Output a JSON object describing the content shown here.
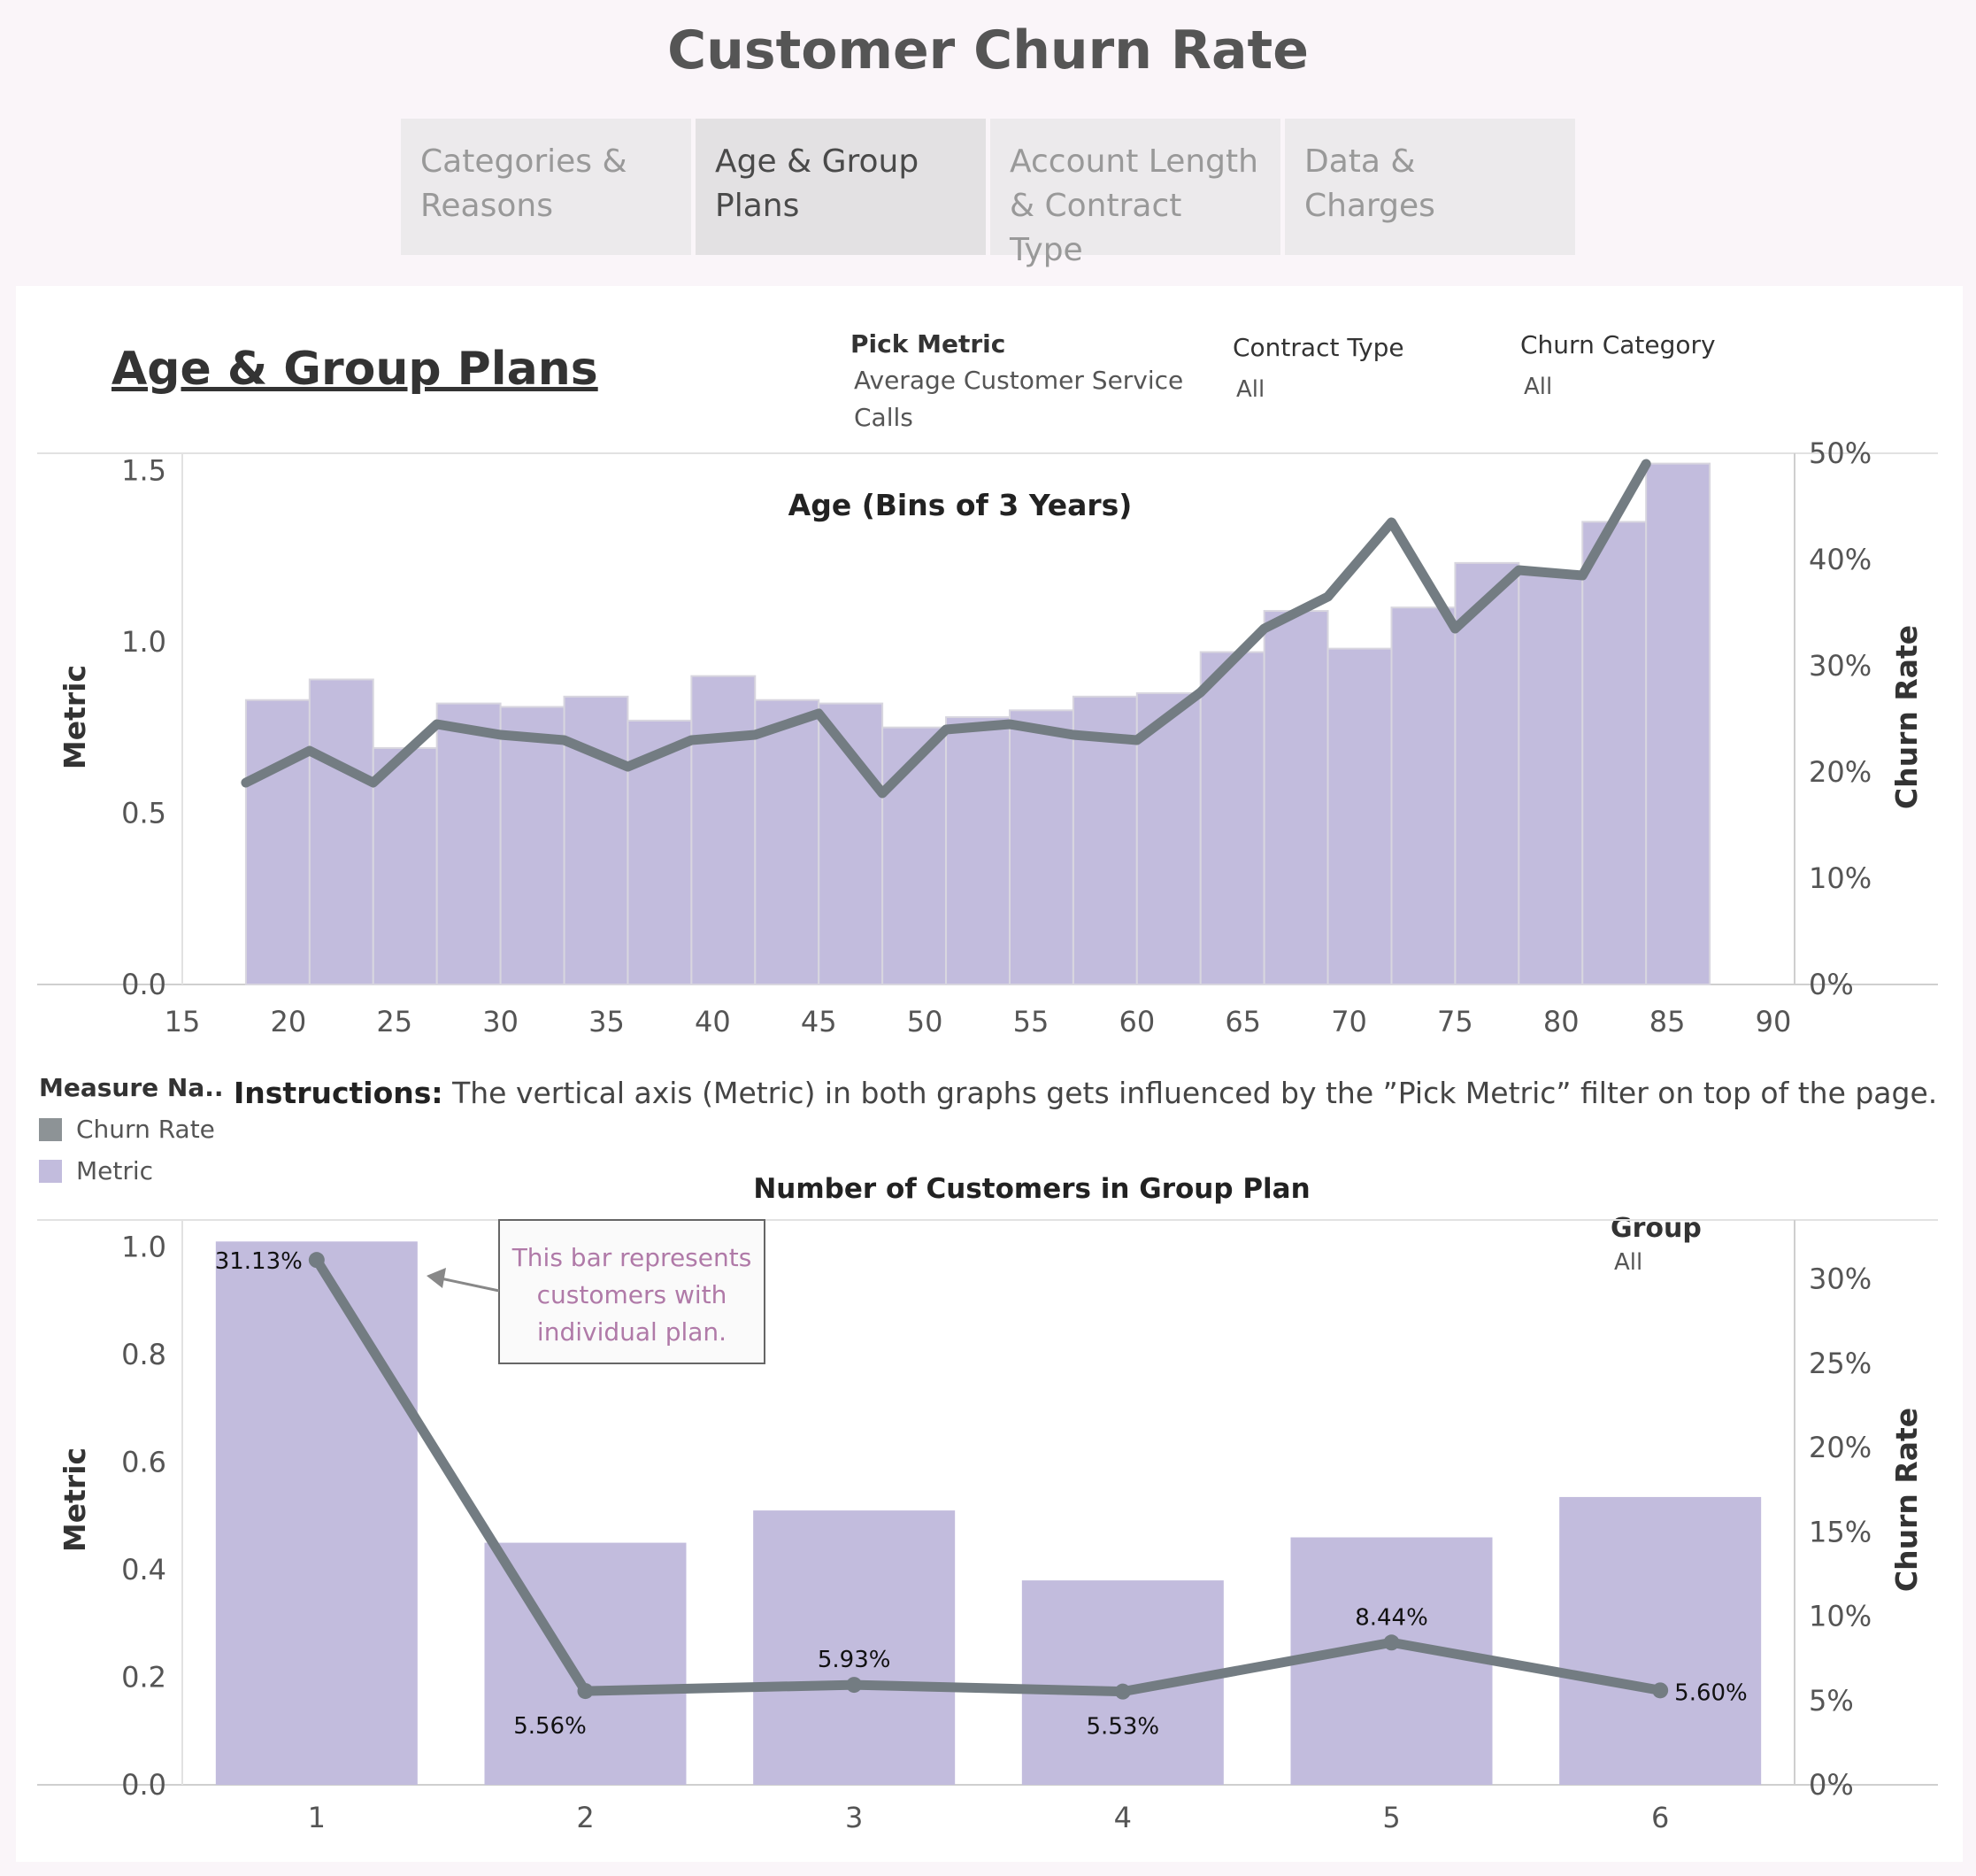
{
  "page_title": "Customer Churn Rate",
  "tabs": [
    {
      "label_lines": [
        "Categories &",
        "Reasons"
      ],
      "active": false
    },
    {
      "label_lines": [
        "Age & Group",
        "Plans"
      ],
      "active": true
    },
    {
      "label_lines": [
        "Account Length",
        "& Contract Type"
      ],
      "active": false
    },
    {
      "label_lines": [
        "Data & Charges"
      ],
      "active": false
    }
  ],
  "section_title": "Age & Group Plans",
  "filters": {
    "pick_metric": {
      "label": "Pick Metric",
      "value_lines": [
        "Average Customer Service",
        "Calls"
      ]
    },
    "contract_type": {
      "label": "Contract Type",
      "value": "All"
    },
    "churn_category": {
      "label": "Churn Category",
      "value": "All"
    },
    "group": {
      "label": "Group",
      "value": "All"
    }
  },
  "legend": {
    "title": "Measure Na..",
    "items": [
      {
        "label": "Churn Rate",
        "color": "#8d9396"
      },
      {
        "label": "Metric",
        "color": "#c2bcdd"
      }
    ]
  },
  "instructions": {
    "prefix": "Instructions:",
    "text": " The vertical axis (Metric) in both graphs gets influenced by the ”Pick Metric” filter on top of the page."
  },
  "colors": {
    "bar": "#c2bcdd",
    "bar_edge": "#d8d6df",
    "line": "#737c82",
    "annotation_text": "#b07aa8"
  },
  "chart_data": [
    {
      "type": "bar",
      "title": "Age (Bins of 3 Years)",
      "xlabel": "",
      "ylabel": "Metric",
      "y2label": "Churn Rate",
      "xlim": [
        15,
        91
      ],
      "ylim": [
        0,
        1.55
      ],
      "y2lim": [
        0,
        0.5
      ],
      "x_ticks": [
        15,
        20,
        25,
        30,
        35,
        40,
        45,
        50,
        55,
        60,
        65,
        70,
        75,
        80,
        85,
        90
      ],
      "y_ticks": [
        "0.0",
        "0.5",
        "1.0",
        "1.5"
      ],
      "y2_ticks": [
        "0%",
        "10%",
        "20%",
        "30%",
        "40%",
        "50%"
      ],
      "bin_width": 3,
      "bins": [
        18,
        21,
        24,
        27,
        30,
        33,
        36,
        39,
        42,
        45,
        48,
        51,
        54,
        57,
        60,
        63,
        66,
        69,
        72,
        75,
        78,
        81,
        84
      ],
      "series": [
        {
          "name": "Metric",
          "kind": "bar",
          "values": [
            0.83,
            0.89,
            0.69,
            0.82,
            0.81,
            0.84,
            0.77,
            0.9,
            0.83,
            0.82,
            0.75,
            0.78,
            0.8,
            0.84,
            0.85,
            0.97,
            1.09,
            0.98,
            1.1,
            1.23,
            1.2,
            1.35,
            1.52
          ]
        },
        {
          "name": "Churn Rate",
          "kind": "line",
          "values": [
            0.19,
            0.22,
            0.19,
            0.245,
            0.235,
            0.23,
            0.205,
            0.23,
            0.235,
            0.255,
            0.18,
            0.24,
            0.245,
            0.235,
            0.23,
            0.275,
            0.335,
            0.365,
            0.435,
            0.335,
            0.39,
            0.385,
            0.49
          ]
        }
      ]
    },
    {
      "type": "bar",
      "title": "Number of Customers in Group Plan",
      "xlabel": "",
      "ylabel": "Metric",
      "y2label": "Churn Rate",
      "ylim": [
        0,
        1.05
      ],
      "y2lim": [
        0,
        0.335
      ],
      "categories": [
        "1",
        "2",
        "3",
        "4",
        "5",
        "6"
      ],
      "y_ticks": [
        "0.0",
        "0.2",
        "0.4",
        "0.6",
        "0.8",
        "1.0"
      ],
      "y2_ticks": [
        "0%",
        "5%",
        "10%",
        "15%",
        "20%",
        "25%",
        "30%"
      ],
      "series": [
        {
          "name": "Metric",
          "kind": "bar",
          "values": [
            1.01,
            0.45,
            0.51,
            0.38,
            0.46,
            0.535
          ]
        },
        {
          "name": "Churn Rate",
          "kind": "line",
          "values": [
            0.3113,
            0.0556,
            0.0593,
            0.0553,
            0.0844,
            0.056
          ],
          "labels": [
            "31.13%",
            "5.56%",
            "5.93%",
            "5.53%",
            "8.44%",
            "5.60%"
          ]
        }
      ],
      "annotation": {
        "text_lines": [
          "This bar represents",
          "customers with",
          "individual plan."
        ]
      }
    }
  ]
}
